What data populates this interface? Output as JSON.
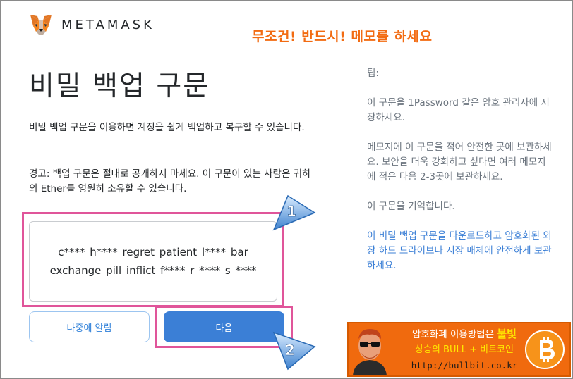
{
  "header": {
    "brand": "METAMASK",
    "memo_note": "무조건! 반드시! 메모를 하세요"
  },
  "main": {
    "title": "비밀 백업 구문",
    "intro": "비밀 백업 구문을 이용하면 계정을 쉽게 백업하고 복구할 수 있습니다.",
    "warning": "경고: 백업 구문은 절대로 공개하지 마세요. 이 구문이 있는 사람은 귀하의 Ether를 영원히 소유할 수 있습니다.",
    "seed_phrase": "c**** h**** regret patient l**** bar exchange pill inflict f**** r **** s ****",
    "remind_later_label": "나중에 알림",
    "next_label": "다음"
  },
  "tips": {
    "heading": "팁:",
    "tip1": "이 구문을 1Password 같은 암호 관리자에 저장하세요.",
    "tip2": "메모지에 이 구문을 적어 안전한 곳에 보관하세요. 보안을 더욱 강화하고 싶다면 여러 메모지에 적은 다음 2-3곳에 보관하세요.",
    "tip3": "이 구문을 기억합니다.",
    "tip4_link": "이 비밀 백업 구문을 다운로드하고 암호화된 외장 하드 드라이브나 저장 매체에 안전하게 보관하세요."
  },
  "callouts": {
    "step1": "1",
    "step2": "2"
  },
  "ad": {
    "line1_prefix": "암호화폐 이용방법은 ",
    "line1_accent": "불빛",
    "line2": "상승의 BULL + 비트코인",
    "line3": "http://bullbit.co.kr"
  },
  "colors": {
    "accent_blue": "#3b7fd6",
    "highlight_pink": "#e0559a",
    "memo_orange": "#f26b12",
    "ad_orange": "#f06a0e"
  }
}
